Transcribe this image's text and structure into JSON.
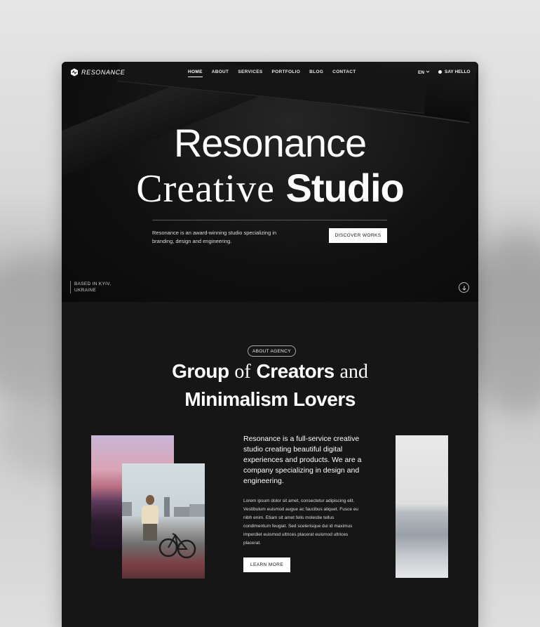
{
  "brand": {
    "name": "RESONANCE"
  },
  "nav": {
    "items": [
      {
        "label": "HOME",
        "active": true
      },
      {
        "label": "ABOUT"
      },
      {
        "label": "SERVICES"
      },
      {
        "label": "PORTFOLIO"
      },
      {
        "label": "BLOG"
      },
      {
        "label": "CONTACT"
      }
    ],
    "language": "EN",
    "say_hello": "SAY HELLO"
  },
  "hero": {
    "title_line1": "Resonance",
    "title_line2_serif": "Creative",
    "title_line2_sans": "Studio",
    "description": "Resonance is an award-winning studio specializing in branding, design and engineering.",
    "cta": "DISCOVER WORKS",
    "location": "BASED IN KYIV,\nUKRAINE"
  },
  "about": {
    "tag": "ABOUT AGENCY",
    "heading": {
      "w1": "Group",
      "w2": "of",
      "w3": "Creators",
      "w4": "and",
      "line2": "Minimalism Lovers"
    },
    "lead": "Resonance is a full-service creative studio creating beautiful digital experiences and products. We are a company specializing in design and engineering.",
    "body": "Lorem ipsum dolor sit amet, consectetur adipiscing elit. Vestibulum euismod augue ac faucibus aliquet. Fusce eu nibh enim. Etiam sit amet felis molestie tellus condimentum feugiat. Sed scelerisque dui id maximus imperdiet euismod ultrices placerat euismod ultrices placerat.",
    "cta": "LEARN MORE"
  },
  "icons": [
    "logo-wave-icon",
    "chevron-down-icon",
    "dot-icon",
    "arrow-down-icon"
  ],
  "colors": {
    "background": "#141414",
    "text": "#ffffff",
    "button_bg": "#ffffff"
  }
}
